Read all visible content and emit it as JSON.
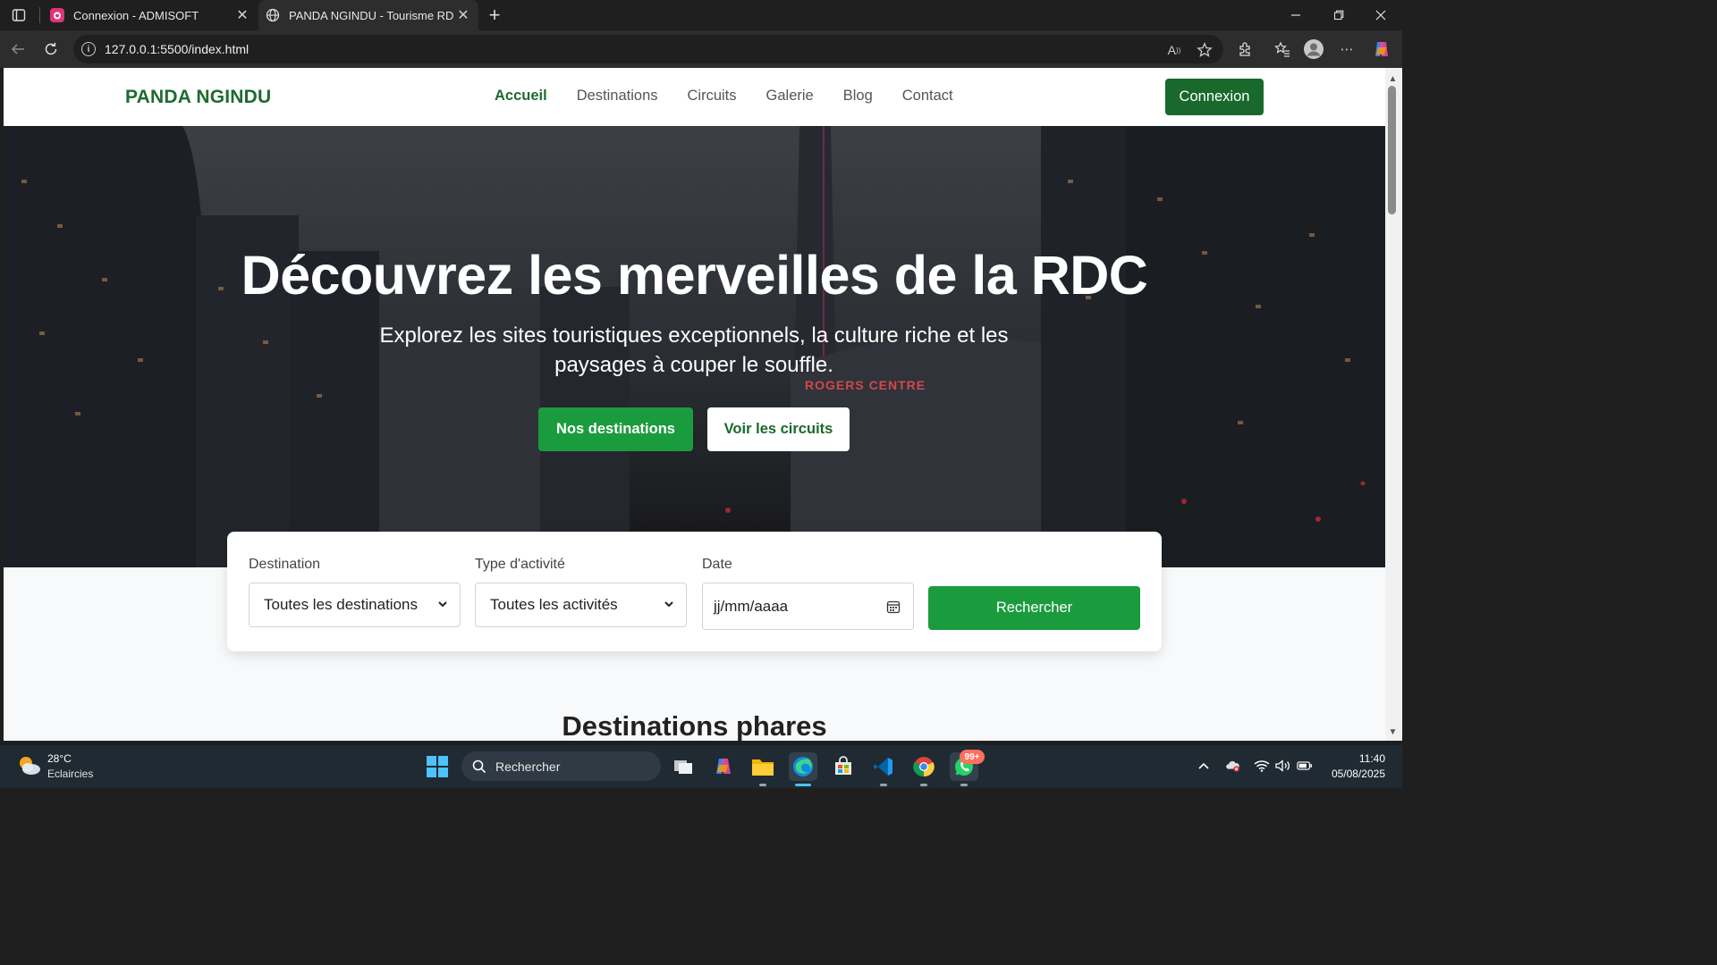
{
  "browser": {
    "tabs": [
      {
        "title": "Connexion - ADMISOFT",
        "active": false
      },
      {
        "title": "PANDA NGINDU - Tourisme RDC",
        "active": true
      }
    ],
    "url": "127.0.0.1:5500/index.html"
  },
  "site": {
    "brand": "PANDA NGINDU",
    "nav": [
      "Accueil",
      "Destinations",
      "Circuits",
      "Galerie",
      "Blog",
      "Contact"
    ],
    "active_nav": "Accueil",
    "login_label": "Connexion",
    "colors": {
      "brand": "#1e6b30",
      "primary": "#1a9c3e",
      "login": "#19692c"
    }
  },
  "hero": {
    "title": "Découvrez les merveilles de la RDC",
    "subtitle": "Explorez les sites touristiques exceptionnels, la culture riche et les paysages à couper le souffle.",
    "btn_primary": "Nos destinations",
    "btn_secondary": "Voir les circuits",
    "sign_text": "ROGERS CENTRE"
  },
  "search": {
    "destination_label": "Destination",
    "destination_value": "Toutes les destinations",
    "activity_label": "Type d'activité",
    "activity_value": "Toutes les activités",
    "date_label": "Date",
    "date_placeholder": "jj/mm/aaaa",
    "button": "Rechercher"
  },
  "sections": {
    "featured_title": "Destinations phares"
  },
  "taskbar": {
    "weather_temp": "28°C",
    "weather_desc": "Eclaircies",
    "search_placeholder": "Rechercher",
    "whatsapp_badge": "99+",
    "time": "11:40",
    "date": "05/08/2025"
  }
}
